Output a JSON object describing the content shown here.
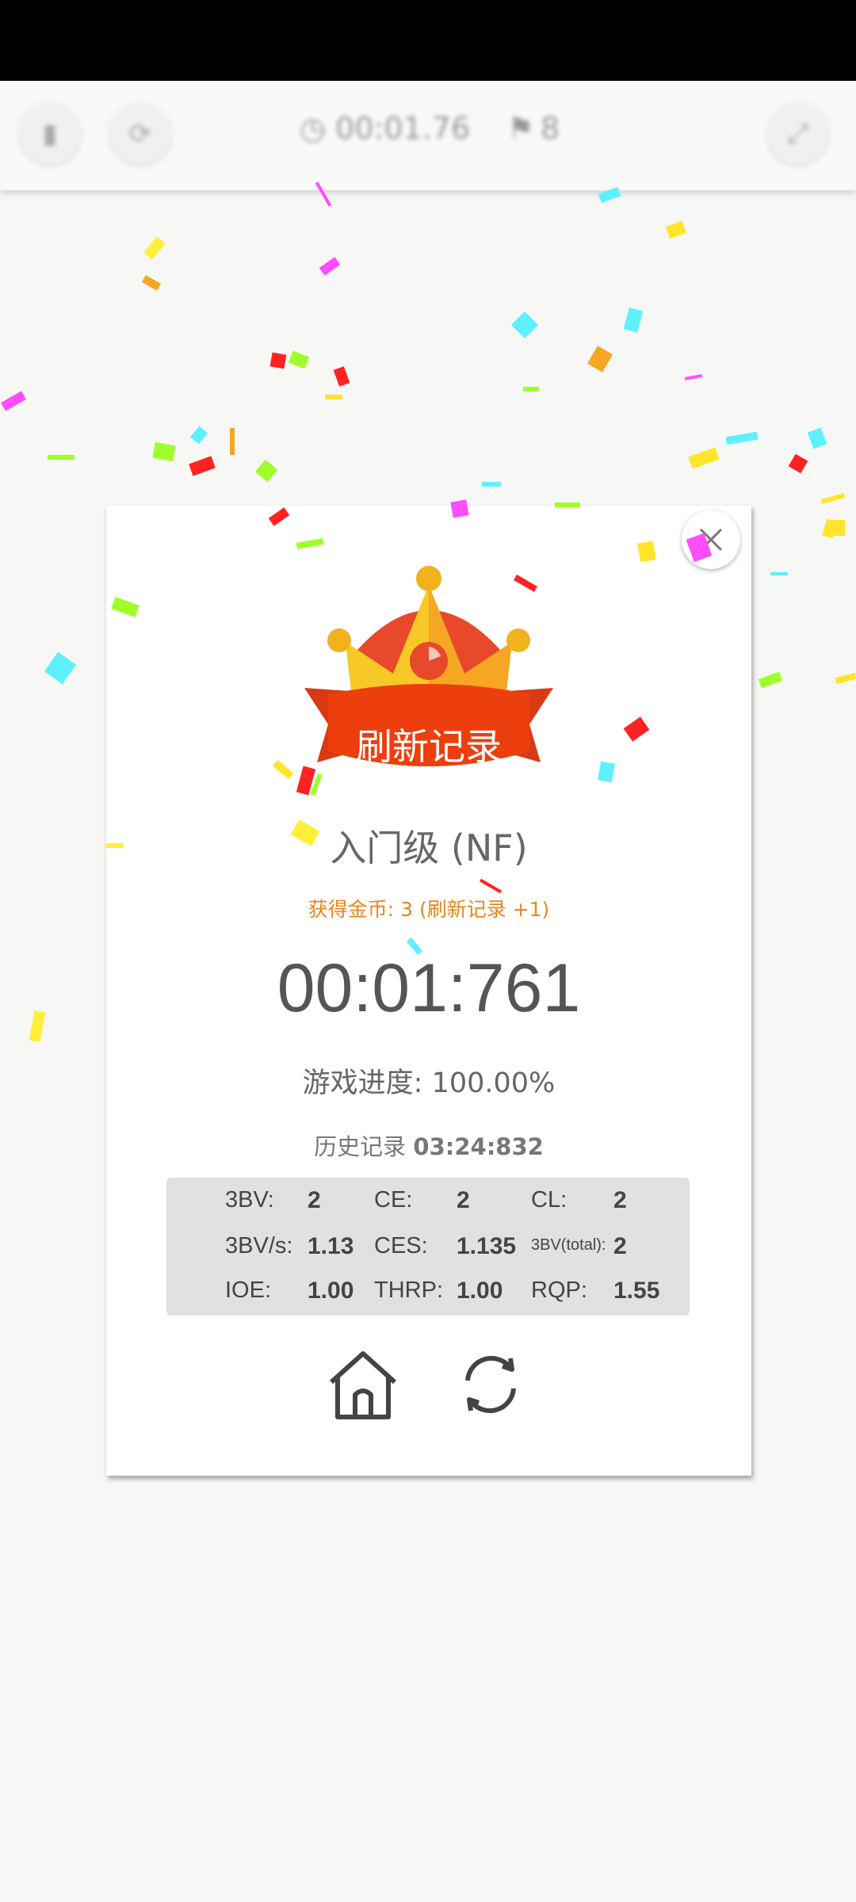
{
  "toolbar": {
    "timer": "00:01.76",
    "flags": "8"
  },
  "modal": {
    "banner": "刷新记录",
    "level": "入门级 (NF)",
    "coins": "获得金币: 3 (刷新记录 +1)",
    "time": "00:01:761",
    "progress_label": "游戏进度:",
    "progress_value": "100.00%",
    "history_label": "历史记录",
    "history_value": "03:24:832",
    "stats": {
      "bv": {
        "label": "3BV:",
        "value": "2"
      },
      "ce": {
        "label": "CE:",
        "value": "2"
      },
      "cl": {
        "label": "CL:",
        "value": "2"
      },
      "bvs": {
        "label": "3BV/s:",
        "value": "1.13"
      },
      "ces": {
        "label": "CES:",
        "value": "1.135"
      },
      "bvtotal": {
        "label": "3BV(total):",
        "value": "2"
      },
      "ioe": {
        "label": "IOE:",
        "value": "1.00"
      },
      "thrp": {
        "label": "THRP:",
        "value": "1.00"
      },
      "rqp": {
        "label": "RQP:",
        "value": "1.55"
      }
    }
  },
  "icons": {
    "close": "close-icon",
    "home": "home-icon",
    "restart": "restart-icon"
  },
  "colors": {
    "banner_red": "#e83a14",
    "crown_gold": "#f5b325",
    "coins_orange": "#e8861f"
  }
}
